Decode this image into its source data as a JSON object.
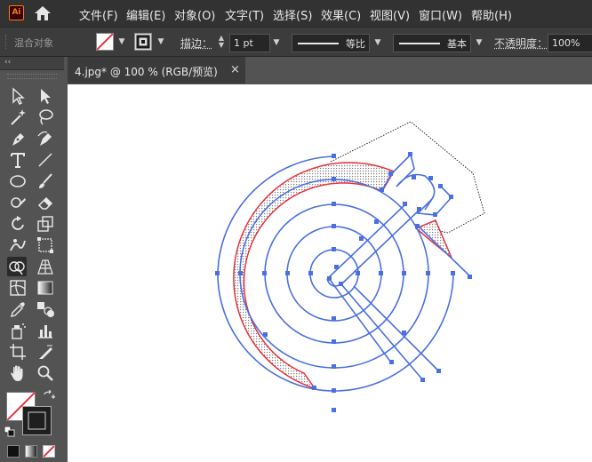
{
  "app": {
    "logo_text": "Ai"
  },
  "menu": [
    "文件(F)",
    "编辑(E)",
    "对象(O)",
    "文字(T)",
    "选择(S)",
    "效果(C)",
    "视图(V)",
    "窗口(W)",
    "帮助(H)"
  ],
  "control_bar": {
    "selection_label": "混合对象",
    "stroke_label": "描边：",
    "stroke_width": "1 pt",
    "variable_width_profile": "等比",
    "brush_definition": "基本",
    "opacity_label": "不透明度：",
    "opacity_value": "100%"
  },
  "document_tab": {
    "title": "4.jpg* @ 100 % (RGB/预览)",
    "close_glyph": "×"
  },
  "tool_panel": {
    "collapse_glyph": "‹‹"
  },
  "colors": {
    "selection_blue": "#4a6fe3",
    "path_red": "#e8323c",
    "accent_orange": "#ff7c00"
  }
}
